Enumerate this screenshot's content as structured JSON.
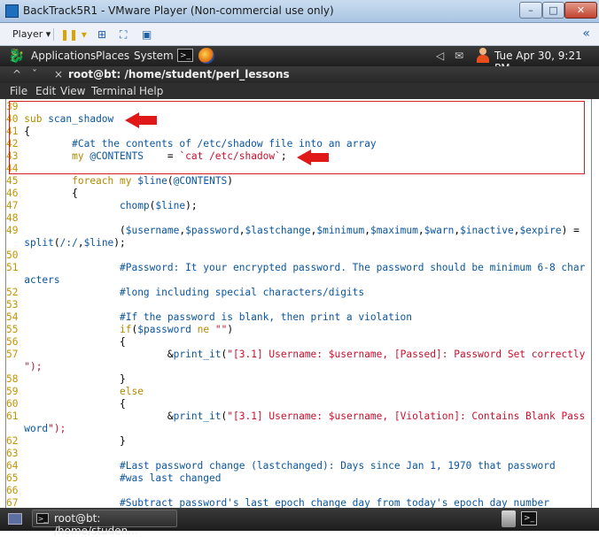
{
  "window": {
    "title": "BackTrack5R1 - VMware Player (Non-commercial use only)",
    "min_glyph": "–",
    "max_glyph": "□",
    "close_glyph": "✕"
  },
  "vm_toolbar": {
    "player_label": "Player ▾",
    "pause_glyph": "❚❚ ▾",
    "network_glyph": "⊞",
    "fullscreen_glyph": "⛶",
    "unity_glyph": "▣",
    "collapse_glyph": "«"
  },
  "gnome_panel": {
    "menus": [
      "Applications",
      "Places",
      "System"
    ],
    "term_icon_text": ">_",
    "volume_glyph": "◁",
    "mail_glyph": "✉",
    "clock": "Tue Apr 30,  9:21 PM"
  },
  "terminal": {
    "title": "root@bt: /home/student/perl_lessons",
    "up_glyph": "^",
    "down_glyph": "ˇ",
    "close_glyph": "×",
    "menu": [
      "File",
      "Edit",
      "View",
      "Terminal",
      "Help"
    ]
  },
  "code_lines": [
    "39",
    "40 sub scan_shadow",
    "41 {",
    "42         #Cat the contents of /etc/shadow file into an array",
    "43         my @CONTENTS    = `cat /etc/shadow`;",
    "44",
    "45         foreach my $line(@CONTENTS)",
    "46         {",
    "47                 chomp($line);",
    "48",
    "49                 ($username,$password,$lastchange,$minimum,$maximum,$warn,$inactive,$expire) =",
    "   split(/:/,$line);",
    "50",
    "51                 #Password: It your encrypted password. The password should be minimum 6-8 char",
    "   acters",
    "52                 #long including special characters/digits",
    "53",
    "54                 #If the password is blank, then print a violation",
    "55                 if($password ne \"\")",
    "56                 {",
    "57                         &print_it(\"[3.1] Username: $username, [Passed]: Password Set correctly",
    "   \");",
    "58                 }",
    "59                 else",
    "60                 {",
    "61                         &print_it(\"[3.1] Username: $username, [Violation]: Contains Blank Pass",
    "   word\");",
    "62                 }",
    "63",
    "64                 #Last password change (lastchanged): Days since Jan 1, 1970 that password",
    "65                 #was last changed",
    "66",
    "67                 #Subtract password's last epoch change day from today's epoch day number"
  ],
  "taskbar": {
    "task_label": "root@bt: /home/studen...",
    "term_icon_text": ">_"
  },
  "colors": {
    "annotation_red": "#e01818",
    "line_number": "#c29400",
    "code_blue": "#0a56a0",
    "string_red": "#c8102e"
  }
}
